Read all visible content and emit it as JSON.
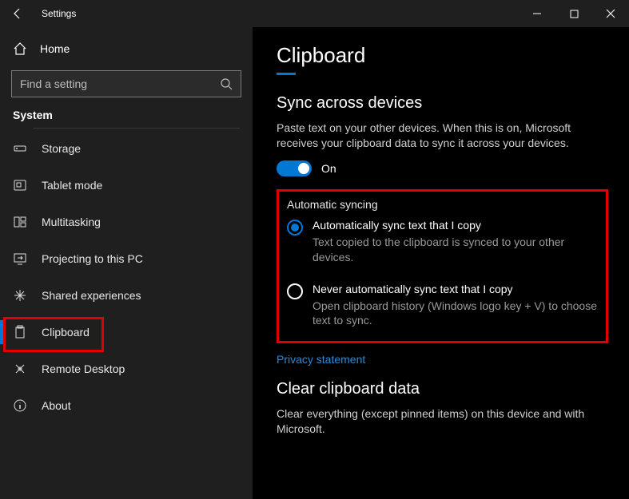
{
  "window": {
    "title": "Settings"
  },
  "sidebar": {
    "home_label": "Home",
    "search_placeholder": "Find a setting",
    "section_label": "System",
    "items": [
      {
        "icon": "storage-icon",
        "label": "Storage"
      },
      {
        "icon": "tablet-icon",
        "label": "Tablet mode"
      },
      {
        "icon": "multitask-icon",
        "label": "Multitasking"
      },
      {
        "icon": "projecting-icon",
        "label": "Projecting to this PC"
      },
      {
        "icon": "shared-icon",
        "label": "Shared experiences"
      },
      {
        "icon": "clipboard-icon",
        "label": "Clipboard"
      },
      {
        "icon": "remote-icon",
        "label": "Remote Desktop"
      },
      {
        "icon": "about-icon",
        "label": "About"
      }
    ],
    "selected_index": 5
  },
  "page": {
    "title": "Clipboard",
    "sync": {
      "heading": "Sync across devices",
      "description": "Paste text on your other devices. When this is on, Microsoft receives your clipboard data to sync it across your devices.",
      "toggle_state": "On",
      "toggle_on": true
    },
    "auto_sync": {
      "heading": "Automatic syncing",
      "options": [
        {
          "label": "Automatically sync text that I copy",
          "hint": "Text copied to the clipboard is synced to your other devices.",
          "selected": true
        },
        {
          "label": "Never automatically sync text that I copy",
          "hint": "Open clipboard history (Windows logo key + V) to choose text to sync.",
          "selected": false
        }
      ]
    },
    "privacy_link": "Privacy statement",
    "clear": {
      "heading": "Clear clipboard data",
      "description": "Clear everything (except pinned items) on this device and with Microsoft."
    }
  }
}
